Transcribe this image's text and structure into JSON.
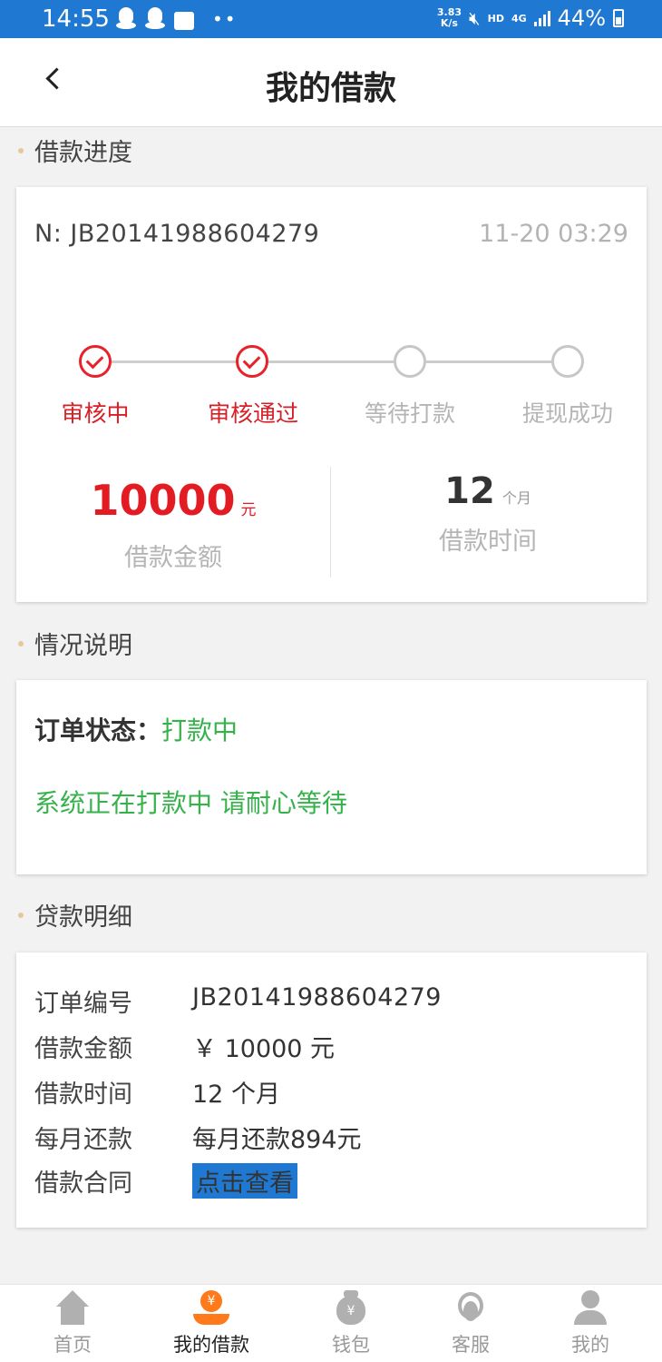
{
  "status_bar": {
    "time": "14:55",
    "speed_value": "3.83",
    "speed_unit": "K/s",
    "hd": "HD",
    "network": "4G",
    "battery": "44%"
  },
  "header": {
    "title": "我的借款"
  },
  "progress_section": {
    "title": "借款进度",
    "order_no": "N: JB20141988604279",
    "time": "11-20 03:29",
    "steps": [
      {
        "label": "审核中",
        "state": "done"
      },
      {
        "label": "审核通过",
        "state": "done"
      },
      {
        "label": "等待打款",
        "state": "todo"
      },
      {
        "label": "提现成功",
        "state": "todo"
      }
    ],
    "amount": {
      "value": "10000",
      "unit": "元",
      "label": "借款金额"
    },
    "term": {
      "value": "12",
      "unit": "个月",
      "label": "借款时间"
    }
  },
  "status_section": {
    "title": "情况说明",
    "status_key": "订单状态：",
    "status_value": "打款中",
    "message": "系统正在打款中 请耐心等待"
  },
  "detail_section": {
    "title": "贷款明细",
    "rows": [
      {
        "key": "订单编号",
        "value": "JB20141988604279"
      },
      {
        "key": "借款金额",
        "value": "￥ 10000 元"
      },
      {
        "key": "借款时间",
        "value": "12 个月"
      },
      {
        "key": "每月还款",
        "value": "每月还款894元"
      },
      {
        "key": "借款合同",
        "value": "点击查看"
      }
    ]
  },
  "bottom_nav": {
    "items": [
      {
        "label": "首页",
        "icon": "home-icon"
      },
      {
        "label": "我的借款",
        "icon": "loan-icon",
        "active": true
      },
      {
        "label": "钱包",
        "icon": "wallet-icon"
      },
      {
        "label": "客服",
        "icon": "customer-service-icon"
      },
      {
        "label": "我的",
        "icon": "user-icon"
      }
    ]
  },
  "colors": {
    "status_bar": "#1f78d1",
    "accent_red": "#e31b23",
    "accent_green": "#36b24a",
    "nav_active": "#ff7a1a"
  }
}
